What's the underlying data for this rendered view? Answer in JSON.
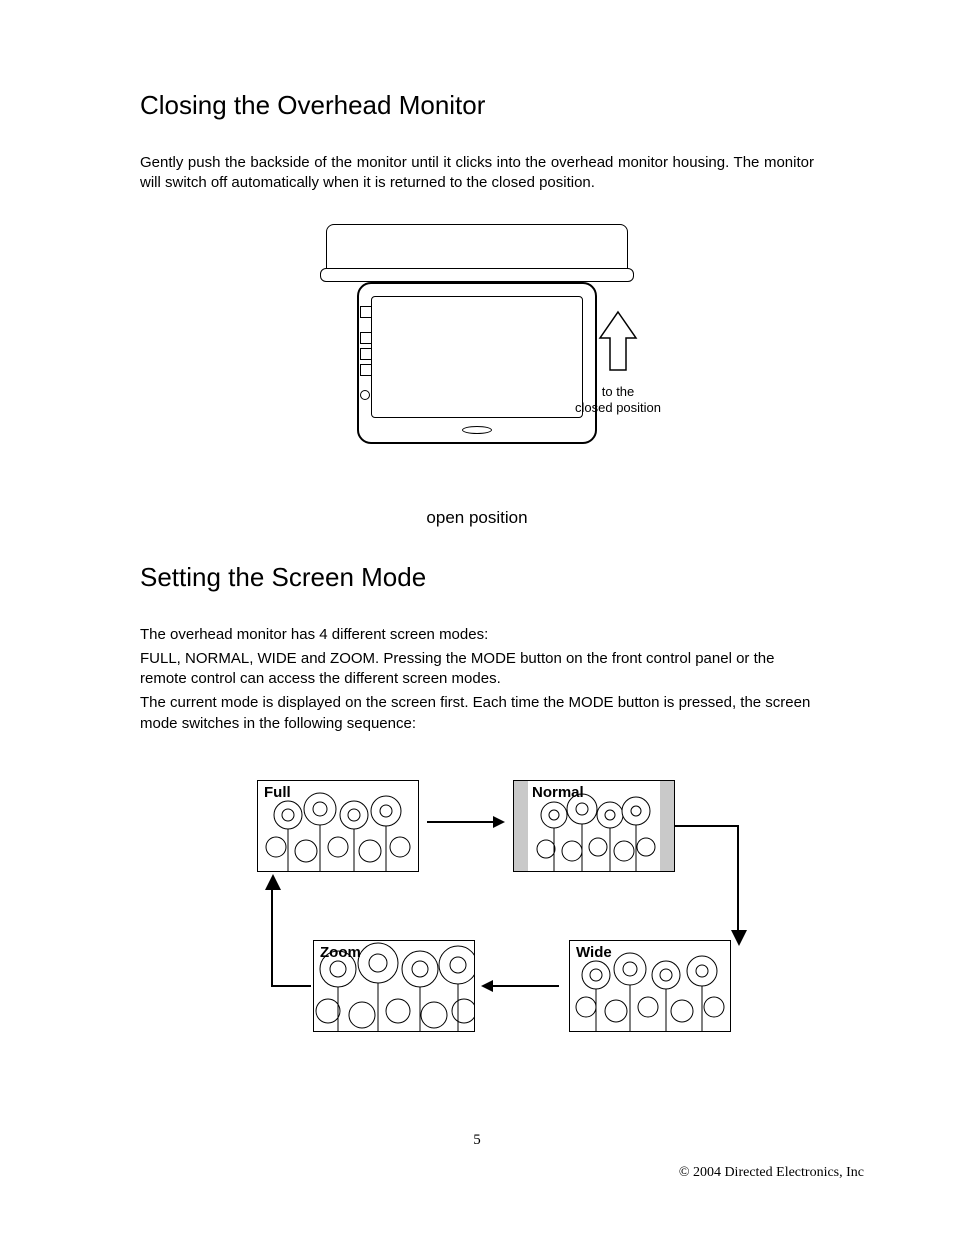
{
  "section1": {
    "heading": "Closing the Overhead Monitor",
    "paragraph": "Gently push the backside of the monitor until it clicks into the overhead monitor housing. The monitor will switch off automatically when it is returned to the closed position."
  },
  "figure1": {
    "arrow_label_line1": "to the",
    "arrow_label_line2": "closed position",
    "caption": "open position"
  },
  "section2": {
    "heading": "Setting the Screen Mode",
    "para_line1": "The overhead monitor has 4 different screen modes:",
    "para_line2": "FULL, NORMAL, WIDE and ZOOM. Pressing the MODE button on the front control panel or the remote control can access the different screen modes.",
    "para_line3": "The current mode is displayed on the screen first. Each time the MODE button is pressed, the screen mode switches in the following sequence:"
  },
  "modes": {
    "full": "Full",
    "normal": "Normal",
    "wide": "Wide",
    "zoom": "Zoom"
  },
  "page_number": "5",
  "copyright": "© 2004 Directed Electronics, Inc"
}
